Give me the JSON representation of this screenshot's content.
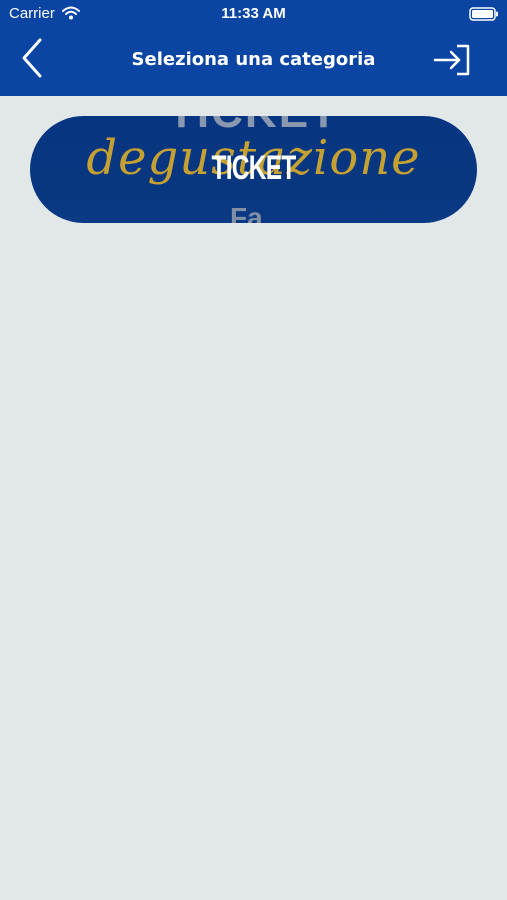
{
  "status_bar": {
    "carrier": "Carrier",
    "time": "11:33 AM"
  },
  "nav": {
    "title": "Seleziona una categoria",
    "back_icon": "chevron-left-icon",
    "login_icon": "sign-in-icon"
  },
  "categories": [
    {
      "label": "TICKET",
      "background_text": {
        "ticket": "TICKET",
        "script": "degustazione",
        "extra": "Fa"
      }
    }
  ],
  "colors": {
    "primary": "#0a45a4",
    "card_blue": "#08367f",
    "gold": "#c4a132",
    "background": "#e2e8e8"
  }
}
